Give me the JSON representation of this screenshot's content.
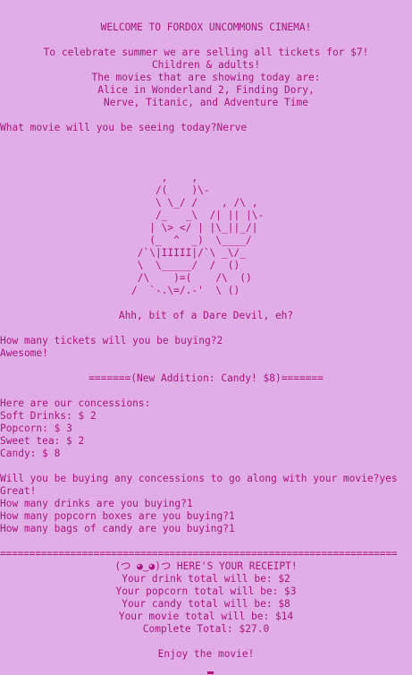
{
  "header": {
    "welcome": "WELCOME TO FORDOX UNCOMMONS CINEMA!",
    "promo_1": "To celebrate summer we are selling all tickets for $7!",
    "promo_2": "Children & adults!",
    "promo_3": "The movies that are showing today are:",
    "movies_1": "Alice in Wonderland 2, Finding Dory,",
    "movies_2": "Nerve, Titanic, and Adventure Time"
  },
  "movie_prompt": {
    "question": "What movie will you be seeing today?",
    "answer": "Nerve"
  },
  "ascii_art": "     ,    ,\n    /(    )\\-\n    \\ \\_/ /    , /\\ ,\n    /_   _\\  /| || |\\-\n   | \\> </ | |\\_||_/|\n   (_  ^  _)  \\____/\n /`\\|IIIII|/`\\ _\\/_\n \\  \\_____/  /  ()\n /\\    )=(    /\\  ()\n/  `-.\\=/.-'  \\ ()",
  "movie_reaction": "Ahh, bit of a Dare Devil, eh?",
  "tickets_prompt": {
    "question": "How many tickets will you be buying?",
    "answer": "2",
    "reaction": "Awesome!"
  },
  "candy_banner": "=======(New Addition: Candy! $8)=======",
  "concessions": {
    "title": "Here are our concessions:",
    "items": [
      "Soft Drinks: $ 2",
      "Popcorn: $ 3",
      "Sweet tea: $ 2",
      "Candy: $ 8"
    ]
  },
  "concessions_prompt": {
    "question": "Will you be buying any concessions to go along with your movie?",
    "answer": "yes",
    "reaction": "Great!"
  },
  "quantities": [
    {
      "question": "How many drinks are you buying?",
      "answer": "1"
    },
    {
      "question": "How many popcorn boxes are you buying?",
      "answer": "1"
    },
    {
      "question": "How many bags of candy are you buying?",
      "answer": "1"
    }
  ],
  "divider": "====================================================================",
  "receipt": {
    "title": "(つ ◕‿◕)つ HERE'S YOUR RECEIPT!",
    "lines": [
      "Your drink total will be: $2",
      "Your popcorn total will be: $3",
      "Your candy total will be: $8",
      "Your movie total will be: $14"
    ],
    "complete_total": "Complete Total: $27.0"
  },
  "farewell": "Enjoy the movie!",
  "colors": {
    "background": "#e1ade7",
    "text": "#a8167a"
  }
}
